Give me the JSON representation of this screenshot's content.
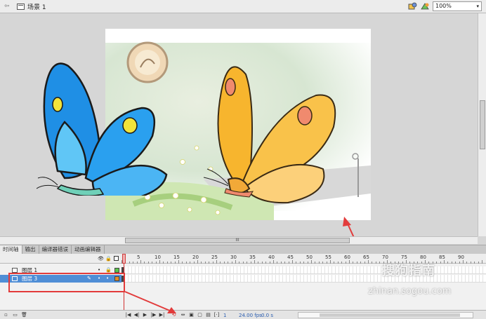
{
  "editbar": {
    "scene_label": "场景 1",
    "zoom_value": "100%",
    "icons": [
      "back-arrow-icon",
      "scene-icon",
      "edit-symbols-icon",
      "edit-scene-icon"
    ]
  },
  "tabs": [
    {
      "label": "时间轴",
      "active": true
    },
    {
      "label": "输出",
      "active": false
    },
    {
      "label": "编译器错误",
      "active": false
    },
    {
      "label": "动画编辑器",
      "active": false
    }
  ],
  "ruler": {
    "numbers": [
      "5",
      "10",
      "15",
      "20",
      "25",
      "30",
      "35",
      "40",
      "45",
      "50",
      "55",
      "60",
      "65",
      "70",
      "75",
      "80",
      "85",
      "90"
    ]
  },
  "layers": [
    {
      "name": "图层 1",
      "selected": false,
      "color": "#59c44a"
    },
    {
      "name": "图层 3",
      "selected": true,
      "color": "#e08a25"
    }
  ],
  "footer": {
    "current_frame": "1",
    "fps": "24.00 fps",
    "time": "0.0 s"
  },
  "hscroll_label": "III",
  "watermark": {
    "brand": "搜狗指南",
    "url": "zhinan.sogou.com"
  },
  "colors": {
    "annotation": "#e23b3b",
    "selection": "#4f8ed6",
    "blue_butterfly": "#1d8fe0",
    "yellow_butterfly": "#f5b93a"
  }
}
